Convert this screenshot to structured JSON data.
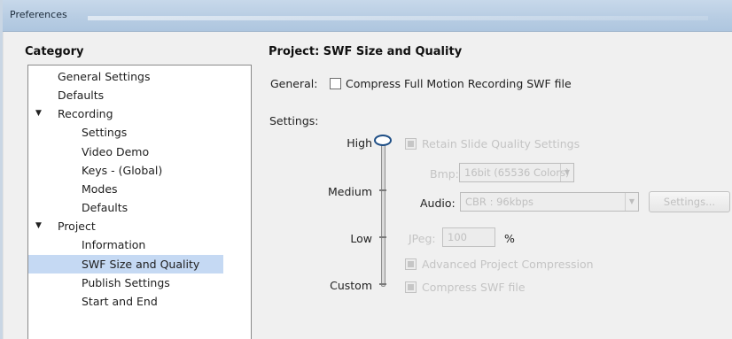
{
  "window": {
    "title": "Preferences"
  },
  "category": {
    "label": "Category",
    "items": [
      {
        "label": "General Settings",
        "expander": ""
      },
      {
        "label": "Defaults",
        "expander": ""
      },
      {
        "label": "Recording",
        "expander": "▼"
      },
      {
        "label": "Settings",
        "expander": ""
      },
      {
        "label": "Video Demo",
        "expander": ""
      },
      {
        "label": "Keys - (Global)",
        "expander": ""
      },
      {
        "label": "Modes",
        "expander": ""
      },
      {
        "label": "Defaults",
        "expander": ""
      },
      {
        "label": "Project",
        "expander": "▼"
      },
      {
        "label": "Information",
        "expander": ""
      },
      {
        "label": "SWF Size and Quality",
        "expander": "",
        "selected": true
      },
      {
        "label": "Publish Settings",
        "expander": ""
      },
      {
        "label": "Start and End",
        "expander": ""
      }
    ]
  },
  "panel": {
    "title": "Project: SWF Size and Quality",
    "general_label": "General:",
    "compress_label": "Compress Full Motion Recording SWF file",
    "settings_label": "Settings:",
    "levels": {
      "high": "High",
      "medium": "Medium",
      "low": "Low",
      "custom": "Custom"
    },
    "retain_label": "Retain Slide Quality Settings",
    "bmp_label": "Bmp:",
    "bmp_value": "16bit (65536 Colors)",
    "audio_label": "Audio:",
    "audio_value": "CBR : 96kbps",
    "settings_button": "Settings...",
    "jpeg_label": "JPeg:",
    "jpeg_value": "100",
    "percent": "%",
    "advanced_label": "Advanced Project Compression",
    "compress_swf_label": "Compress SWF file"
  },
  "colors": {
    "titlebar": "#b8cde3",
    "selection": "#c5d9f3",
    "slider_knob": "#1f4f86"
  }
}
